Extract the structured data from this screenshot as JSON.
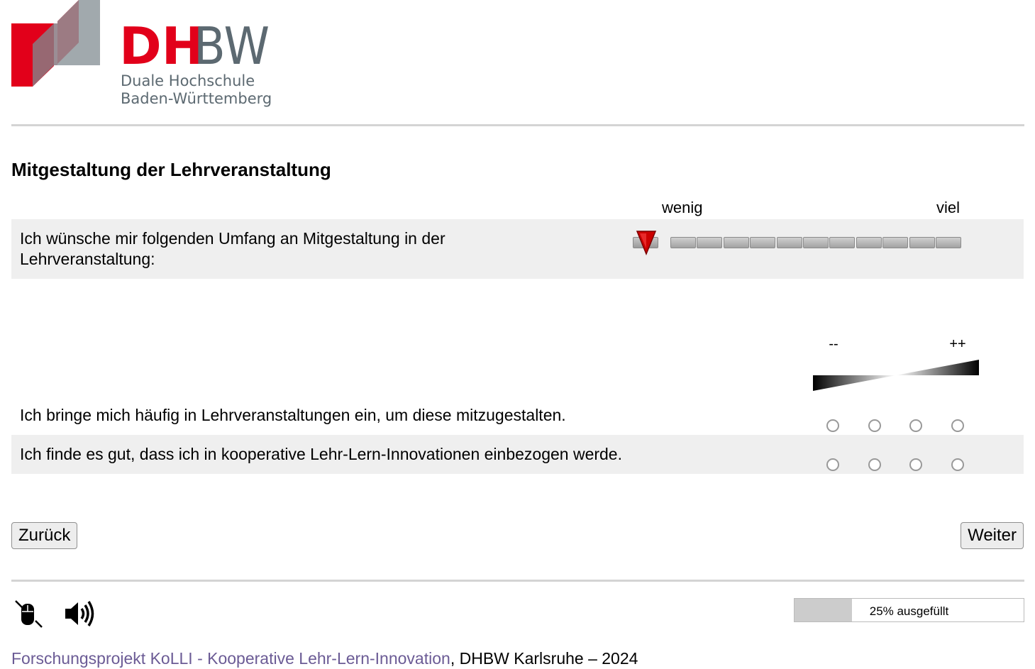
{
  "logo": {
    "wordmark_dh": "DH",
    "wordmark_bw": "BW",
    "line1": "Duale Hochschule",
    "line2": "Baden-Württemberg"
  },
  "colors": {
    "brand_red": "#e2001a",
    "brand_gray": "#5c6971",
    "row_shade": "#efefef",
    "link": "#6b5b95"
  },
  "page_title": "Mitgestaltung der Lehrveranstaltung",
  "scale_question": {
    "label_low": "wenig",
    "label_high": "viel",
    "text": "Ich wünsche mir folgenden Umfang an Mitgestaltung in der Lehrveranstaltung:",
    "segments": 11,
    "selected": "none"
  },
  "matrix": {
    "col_low": "--",
    "col_high": "++",
    "options": 4,
    "rows": [
      {
        "text": "Ich bringe mich häufig in Lehrveranstaltungen ein, um diese mitzugestalten."
      },
      {
        "text": "Ich finde es gut, dass ich in kooperative Lehr-Lern-Innovationen einbezogen werde."
      }
    ]
  },
  "nav": {
    "back": "Zurück",
    "next": "Weiter"
  },
  "footer": {
    "icons": [
      "mouse-cursor-icon",
      "speaker-icon"
    ],
    "progress_value": 0.25,
    "progress_text": "25% ausgefüllt",
    "link_text": "Forschungsprojekt KoLLI - Kooperative Lehr-Lern-Innovation",
    "suffix": ", DHBW Karlsruhe – 2024"
  }
}
